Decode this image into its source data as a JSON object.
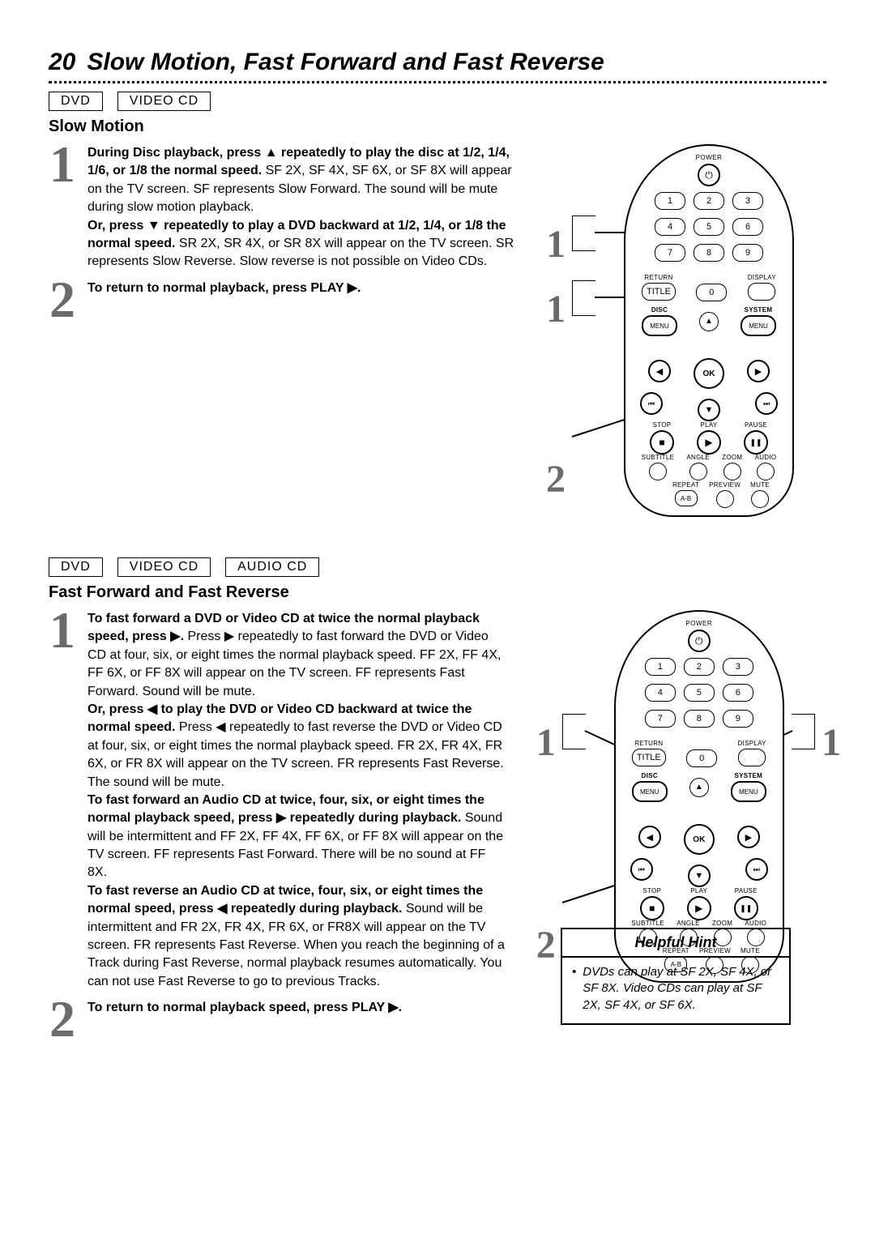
{
  "page_number": "20",
  "page_title": "Slow Motion, Fast Forward and Fast Reverse",
  "tags_section1": [
    "DVD",
    "VIDEO CD"
  ],
  "tags_section2": [
    "DVD",
    "VIDEO CD",
    "AUDIO CD"
  ],
  "section1_heading": "Slow Motion",
  "section2_heading": "Fast Forward and Fast Reverse",
  "glyphs": {
    "up": "▲",
    "down": "▼",
    "play": "▶",
    "left": "◀",
    "right": "▶",
    "prev": "⏮",
    "next": "⏭",
    "stop": "■",
    "pause": "❚❚",
    "power": "⏻"
  },
  "section1": {
    "step1_num": "1",
    "step1_a_bold": "During Disc playback, press ▲ repeatedly to play the disc at 1/2, 1/4, 1/6, or 1/8 the normal speed.",
    "step1_a_rest": " SF 2X, SF 4X, SF 6X, or SF 8X will appear on the TV screen. SF represents Slow Forward. The sound will be mute during slow motion playback.",
    "step1_b_bold": "Or, press ▼ repeatedly to play a DVD backward at 1/2, 1/4, or 1/8 the normal speed.",
    "step1_b_rest": " SR 2X, SR 4X, or SR 8X will appear on the TV screen. SR represents Slow Reverse. Slow reverse is not possible on Video CDs.",
    "step2_num": "2",
    "step2_bold": "To return to normal playback, press PLAY ▶."
  },
  "section2": {
    "step1_num": "1",
    "p1_bold": "To fast forward a DVD or Video CD at twice the normal playback speed, press ▶.",
    "p1_rest": " Press ▶ repeatedly to fast forward the DVD or Video CD at four, six, or eight times the normal playback speed. FF 2X, FF 4X, FF 6X, or FF 8X will appear on the TV screen. FF represents Fast Forward. Sound will be mute.",
    "p2_bold": "Or, press ◀ to play the DVD or Video CD backward at twice the normal speed.",
    "p2_rest": " Press ◀ repeatedly to fast reverse the DVD or Video CD at four, six, or eight times the normal playback speed. FR 2X, FR 4X, FR 6X, or FR 8X will appear on the TV screen. FR represents Fast Reverse. The sound will be mute.",
    "p3_bold": "To fast forward an Audio CD at twice, four, six, or eight times the normal playback speed, press ▶ repeatedly during playback.",
    "p3_rest": " Sound will be intermittent and FF 2X, FF 4X, FF 6X, or FF 8X will appear on the TV screen. FF represents Fast Forward. There will be no sound at FF 8X.",
    "p4_bold": "To fast reverse an Audio CD at twice, four, six, or eight times the normal speed, press ◀ repeatedly during playback.",
    "p4_rest": " Sound will be intermittent and FR 2X, FR 4X, FR 6X, or FR8X will appear on the TV screen. FR represents Fast Reverse. When you reach the beginning of a Track during Fast Reverse, normal playback resumes automatically. You can not use Fast Reverse to go to previous Tracks.",
    "step2_num": "2",
    "step2_bold": "To return to normal playback speed, press PLAY ▶."
  },
  "remote": {
    "power": "POWER",
    "keys": [
      "1",
      "2",
      "3",
      "4",
      "5",
      "6",
      "7",
      "8",
      "9",
      "TITLE",
      "0",
      ""
    ],
    "return": "RETURN",
    "display": "DISPLAY",
    "disc": "DISC",
    "system": "SYSTEM",
    "menu": "MENU",
    "ok": "OK",
    "stop": "STOP",
    "play": "PLAY",
    "pause": "PAUSE",
    "subtitle": "SUBTITLE",
    "angle": "ANGLE",
    "zoom": "ZOOM",
    "audio": "AUDIO",
    "repeat": "REPEAT",
    "preview": "PREVIEW",
    "mute": "MUTE",
    "ab": "A-B"
  },
  "hint": {
    "title": "Helpful Hint",
    "body": "DVDs can play at SF 2X, SF 4X, or SF 8X. Video CDs can play at SF 2X, SF 4X, or SF 6X."
  },
  "callouts": {
    "one": "1",
    "two": "2"
  }
}
